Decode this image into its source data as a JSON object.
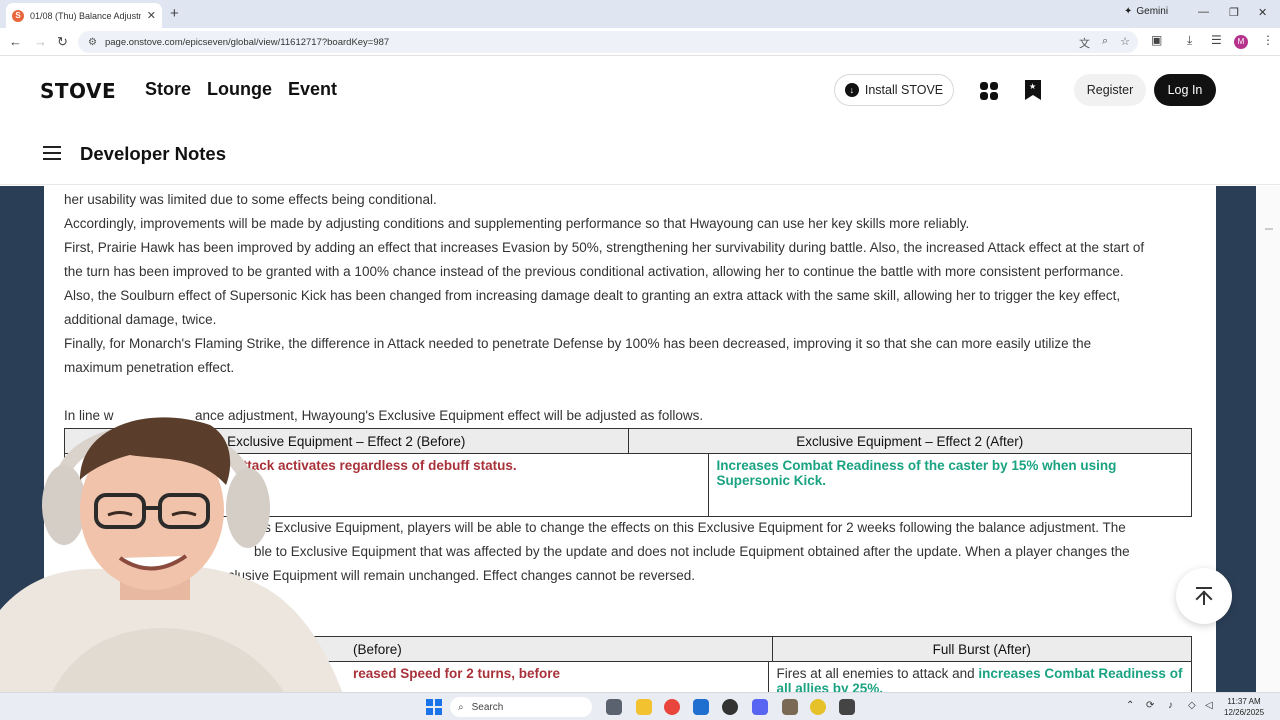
{
  "browser": {
    "tab_title": "01/08 (Thu) Balance Adjustmen",
    "tab_favicon": "S",
    "new_tab": "+",
    "gemini_label": "Gemini",
    "url": "page.onstove.com/epicseven/global/view/11612717?boardKey=987",
    "profile_initial": "M"
  },
  "site": {
    "logo": "STOVE",
    "nav": [
      "Store",
      "Lounge",
      "Event"
    ],
    "install_label": "Install STOVE",
    "register_label": "Register",
    "login_label": "Log In",
    "section_title": "Developer Notes"
  },
  "article": {
    "paragraphs": [
      "her usability was limited due to some effects being conditional.",
      "Accordingly, improvements will be made by adjusting conditions and supplementing performance so that Hwayoung can use her key skills more reliably.",
      "First, Prairie Hawk has been improved by adding an effect that increases Evasion by 50%, strengthening her survivability during battle. Also, the increased Attack effect at the start of",
      "the turn has been improved to be granted with a 100% chance instead of the previous conditional activation, allowing her to continue the battle with more consistent performance.",
      "Also, the Soulburn effect of Supersonic Kick has been changed from increasing damage dealt to granting an extra attack with the same skill, allowing her to trigger the key effect,",
      "additional damage, twice.",
      "Finally, for Monarch's Flaming Strike, the difference in Attack needed to penetrate Defense by 100% has been decreased, improving it so that she can more easily utilize the",
      "maximum penetration effect."
    ],
    "equipment_intro_a": "In line w",
    "equipment_intro_b": "ance adjustment, Hwayoung's Exclusive Equipment effect will be adjusted as follows.",
    "equipment_table": {
      "headers": [
        "Exclusive Equipment – Effect 2 (Before)",
        "Exclusive Equipment – Effect 2 (After)"
      ],
      "before": "Attack activates regardless of debuff status.",
      "after": "Increases Combat Readiness of the caster by 15% when using Supersonic Kick."
    },
    "notice_lines": [
      "g's Exclusive Equipment, players will be able to change the effects on this Exclusive Equipment for 2 weeks following the balance adjustment. The",
      "ble to Exclusive Equipment that was affected by the update and does not include Equipment obtained after the update. When a player changes the",
      "xclusive Equipment will remain unchanged. Effect changes cannot be reversed."
    ],
    "burst_table": {
      "headers": [
        "(Before)",
        "Full Burst (After)"
      ],
      "before": "reased Speed for 2 turns, before",
      "after_plain": "Fires at all enemies to attack and ",
      "after_highlight": "increases Combat Readiness of all allies by 25%,"
    }
  },
  "taskbar": {
    "search_placeholder": "Search",
    "clock_time": "11:37 AM",
    "clock_date": "12/26/2025"
  },
  "colors": {
    "before_text": "#a8323a",
    "after_text": "#1aa382",
    "side_panel": "#2a3e55"
  }
}
